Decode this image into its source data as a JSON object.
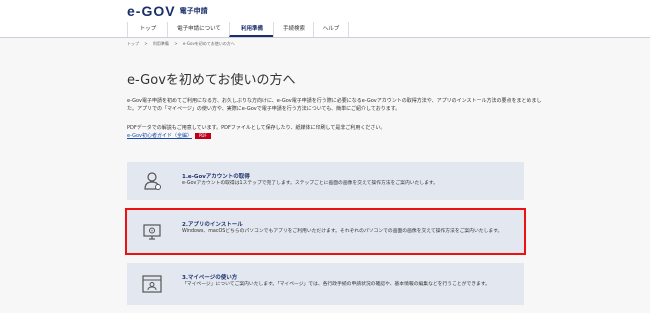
{
  "header": {
    "logo": "e-GOV",
    "logo_sub": "電子申請"
  },
  "nav": {
    "items": [
      "トップ",
      "電子申請について",
      "利用準備",
      "手続検索",
      "ヘルプ"
    ],
    "active": 2
  },
  "breadcrumb": [
    "トップ",
    ">",
    "利用準備",
    ">",
    "e-Govを初めてお使いの方へ"
  ],
  "page_title": "e-Govを初めてお使いの方へ",
  "intro": {
    "p1": "e-Gov電子申請を初めてご利用になる方、お久しぶりな方向けに、e-Gov電子申請を行う際に必要になるe-Govアカウントの取得方法や、アプリのインストール方法の要点をまとめました。アプリでの「マイページ」の使い方や、実際にe-Govで電子申請を行う方法についても、簡単にご紹介しております。",
    "p2": "PDFデータでの解説もご用意しています。PDFファイルとして保存したり、紙媒体に印刷して是非ご利用ください。",
    "guide_link": "e-Gov初心者ガイド（全編）",
    "pdf_badge": "PDF"
  },
  "cards": [
    {
      "title": "1.e-Govアカウントの取得",
      "desc": "e-Govアカウントの取得は1ステップで完了します。ステップごとに画面の画像を交えて操作方法をご案内いたします。",
      "icon": "user-icon"
    },
    {
      "title": "2.アプリのインストール",
      "desc": "Windows、macOSどちらのパソコンでもアプリをご利用いただけます。それぞれのパソコンでの画面の画像を交えて操作方法をご案内いたします。",
      "icon": "computer-icon"
    },
    {
      "title": "3.マイページの使い方",
      "desc": "「マイページ」についてご案内いたします。「マイページ」では、各行政手続の申請状況の確認や、基本情報の編集などを行うことができます。",
      "icon": "mypage-icon"
    }
  ],
  "colors": {
    "brand": "#1a2f6b",
    "card_bg": "#e3e8f0",
    "highlight": "#e11111",
    "pdf": "#c0001a"
  }
}
